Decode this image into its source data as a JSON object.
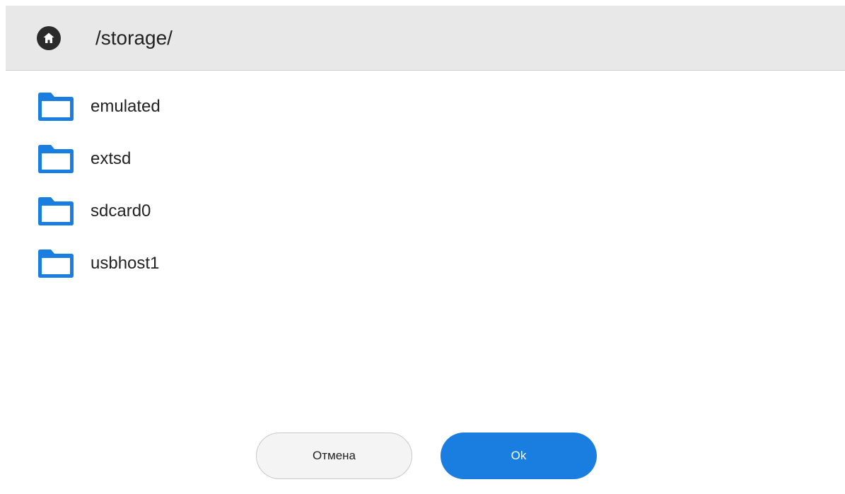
{
  "header": {
    "home_icon": "home-icon",
    "path": "/storage/"
  },
  "folders": [
    {
      "name": "emulated",
      "icon": "folder-icon"
    },
    {
      "name": "extsd",
      "icon": "folder-icon"
    },
    {
      "name": "sdcard0",
      "icon": "folder-icon"
    },
    {
      "name": "usbhost1",
      "icon": "folder-icon"
    }
  ],
  "buttons": {
    "cancel_label": "Отмена",
    "ok_label": "Ok"
  },
  "colors": {
    "header_bg": "#e8e8e8",
    "folder_blue": "#1a7de0",
    "ok_button": "#1a7de0",
    "cancel_button": "#f4f4f4"
  }
}
